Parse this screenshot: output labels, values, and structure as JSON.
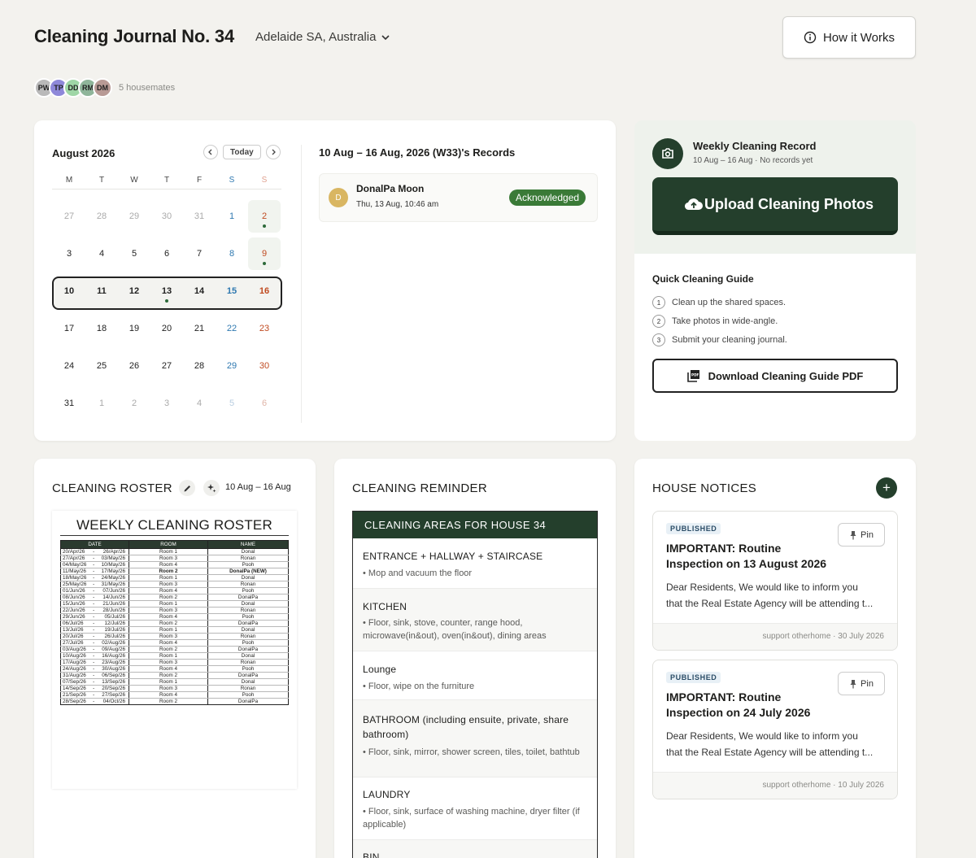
{
  "header": {
    "title": "Cleaning Journal No. 34",
    "location": "Adelaide SA, Australia",
    "how_it_works": "How it Works",
    "avatars": [
      {
        "initials": "PW",
        "color": "#b9b9b9"
      },
      {
        "initials": "TP",
        "color": "#8e88d9"
      },
      {
        "initials": "DD",
        "color": "#9fd6a6"
      },
      {
        "initials": "RM",
        "color": "#8fb59a"
      },
      {
        "initials": "DM",
        "color": "#b89a95"
      }
    ],
    "housemates": "5 housemates"
  },
  "calendar": {
    "month": "August 2026",
    "today": "Today",
    "weekdays": [
      "M",
      "T",
      "W",
      "T",
      "F",
      "S",
      "S"
    ],
    "days": [
      [
        "27",
        "28",
        "29",
        "30",
        "31",
        "1",
        "2"
      ],
      [
        "3",
        "4",
        "5",
        "6",
        "7",
        "8",
        "9"
      ],
      [
        "10",
        "11",
        "12",
        "13",
        "14",
        "15",
        "16"
      ],
      [
        "17",
        "18",
        "19",
        "20",
        "21",
        "22",
        "23"
      ],
      [
        "24",
        "25",
        "26",
        "27",
        "28",
        "29",
        "30"
      ],
      [
        "31",
        "1",
        "2",
        "3",
        "4",
        "5",
        "6"
      ]
    ]
  },
  "records": {
    "title": "10 Aug – 16 Aug, 2026 (W33)'s Records",
    "avatar": "D",
    "name": "DonalPa Moon",
    "time": "Thu, 13 Aug, 10:46 am",
    "status": "Acknowledged"
  },
  "weekly": {
    "title": "Weekly Cleaning Record",
    "subtitle": "10 Aug – 16 Aug · No records yet",
    "upload_label": "Upload Cleaning Photos",
    "guide_title": "Quick Cleaning Guide",
    "steps": [
      {
        "n": "1",
        "text": "Clean up the shared spaces."
      },
      {
        "n": "2",
        "text": "Take photos in wide-angle."
      },
      {
        "n": "3",
        "text": "Submit your cleaning journal."
      }
    ],
    "pdf_label": "Download Cleaning Guide PDF"
  },
  "roster": {
    "title": "CLEANING ROSTER",
    "range": "10 Aug – 16 Aug",
    "image_title": "WEEKLY CLEANING ROSTER",
    "headers": [
      "DATE",
      "ROOM",
      "NAME"
    ],
    "rows": [
      [
        "20/Apr/26",
        "26/Apr/26",
        "Room 1",
        "Donal"
      ],
      [
        "27/Apr/26",
        "03/May/26",
        "Room 3",
        "Ronan"
      ],
      [
        "04/May/26",
        "10/May/26",
        "Room 4",
        "Pooh"
      ],
      [
        "11/May/26",
        "17/May/26",
        "Room 2",
        "DonalPa (NEW)"
      ],
      [
        "18/May/26",
        "24/May/26",
        "Room 1",
        "Donal"
      ],
      [
        "25/May/26",
        "31/May/26",
        "Room 3",
        "Ronan"
      ],
      [
        "01/Jun/26",
        "07/Jun/26",
        "Room 4",
        "Pooh"
      ],
      [
        "08/Jun/26",
        "14/Jun/26",
        "Room 2",
        "DonalPa"
      ],
      [
        "15/Jun/26",
        "21/Jun/26",
        "Room 1",
        "Donal"
      ],
      [
        "22/Jun/26",
        "28/Jun/26",
        "Room 3",
        "Ronan"
      ],
      [
        "29/Jun/26",
        "05/Jul/26",
        "Room 4",
        "Pooh"
      ],
      [
        "06/Jul/26",
        "12/Jul/26",
        "Room 2",
        "DonalPa"
      ],
      [
        "13/Jul/26",
        "19/Jul/26",
        "Room 1",
        "Donal"
      ],
      [
        "20/Jul/26",
        "26/Jul/26",
        "Room 3",
        "Ronan"
      ],
      [
        "27/Jul/26",
        "02/Aug/26",
        "Room 4",
        "Pooh"
      ],
      [
        "03/Aug/26",
        "09/Aug/26",
        "Room 2",
        "DonalPa"
      ],
      [
        "10/Aug/26",
        "16/Aug/26",
        "Room 1",
        "Donal"
      ],
      [
        "17/Aug/26",
        "23/Aug/26",
        "Room 3",
        "Ronan"
      ],
      [
        "24/Aug/26",
        "30/Aug/26",
        "Room 4",
        "Pooh"
      ],
      [
        "31/Aug/26",
        "06/Sep/26",
        "Room 2",
        "DonalPa"
      ],
      [
        "07/Sep/26",
        "13/Sep/26",
        "Room 1",
        "Donal"
      ],
      [
        "14/Sep/26",
        "20/Sep/26",
        "Room 3",
        "Ronan"
      ],
      [
        "21/Sep/26",
        "27/Sep/26",
        "Room 4",
        "Pooh"
      ],
      [
        "28/Sep/26",
        "04/Oct/26",
        "Room 2",
        "DonalPa"
      ]
    ]
  },
  "reminder": {
    "title": "CLEANING REMINDER",
    "box_title": "CLEANING AREAS FOR HOUSE 34",
    "areas": [
      {
        "name": "ENTRANCE + HALLWAY + STAIRCASE",
        "desc": "• Mop and vacuum the floor"
      },
      {
        "name": "KITCHEN",
        "desc": "• Floor, sink, stove, counter, range hood, microwave(in&out), oven(in&out), dining areas"
      },
      {
        "name": "Lounge",
        "desc": "• Floor, wipe on the furniture"
      },
      {
        "name": "BATHROOM (including ensuite, private, share bathroom)",
        "desc": "• Floor, sink, mirror, shower screen, tiles, toilet, bathtub"
      },
      {
        "name": "LAUNDRY",
        "desc": "• Floor, sink, surface of washing machine, dryer filter (if applicable)"
      },
      {
        "name": "BIN",
        "desc": ""
      }
    ]
  },
  "notices": {
    "title": "HOUSE NOTICES",
    "add": "+",
    "items": [
      {
        "status": "PUBLISHED",
        "pin": "Pin",
        "title": "IMPORTANT: Routine Inspection on 13 August 2026",
        "body1": "Dear Residents, We would like to inform you",
        "body2": "that the Real Estate Agency will be attending t...",
        "footer": "support otherhome · 30 July 2026"
      },
      {
        "status": "PUBLISHED",
        "pin": "Pin",
        "title": "IMPORTANT: Routine Inspection on 24 July 2026",
        "body1": "Dear Residents, We would like to inform you",
        "body2": "that the Real Estate Agency will be attending t...",
        "footer": "support otherhome · 10 July 2026"
      }
    ]
  }
}
